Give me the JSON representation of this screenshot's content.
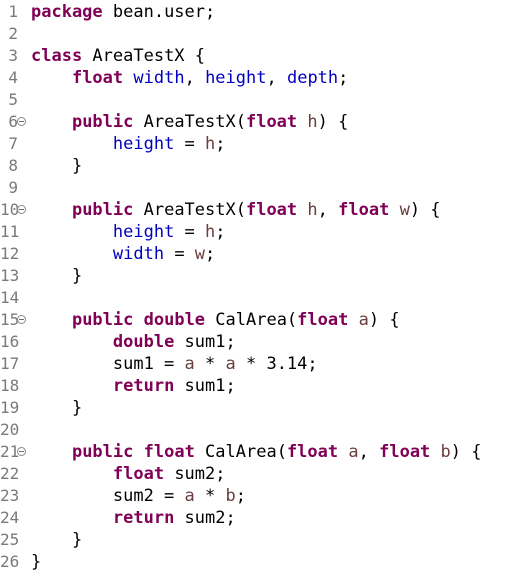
{
  "editor": {
    "lines": [
      {
        "number": "1",
        "tokens": [
          {
            "text": "package",
            "style": "keyword"
          },
          {
            "text": " bean.user;",
            "style": "plain"
          }
        ]
      },
      {
        "number": "2",
        "tokens": []
      },
      {
        "number": "3",
        "tokens": [
          {
            "text": "class",
            "style": "keyword"
          },
          {
            "text": " AreaTestX {",
            "style": "plain"
          }
        ]
      },
      {
        "number": "4",
        "tokens": [
          {
            "text": "    ",
            "style": "plain"
          },
          {
            "text": "float",
            "style": "keyword"
          },
          {
            "text": " ",
            "style": "plain"
          },
          {
            "text": "width",
            "style": "field"
          },
          {
            "text": ", ",
            "style": "plain"
          },
          {
            "text": "height",
            "style": "field"
          },
          {
            "text": ", ",
            "style": "plain"
          },
          {
            "text": "depth",
            "style": "field"
          },
          {
            "text": ";",
            "style": "plain"
          }
        ]
      },
      {
        "number": "5",
        "tokens": []
      },
      {
        "number": "6",
        "fold": true,
        "tokens": [
          {
            "text": "    ",
            "style": "plain"
          },
          {
            "text": "public",
            "style": "keyword"
          },
          {
            "text": " AreaTestX(",
            "style": "plain"
          },
          {
            "text": "float",
            "style": "keyword"
          },
          {
            "text": " ",
            "style": "plain"
          },
          {
            "text": "h",
            "style": "param"
          },
          {
            "text": ") {",
            "style": "plain"
          }
        ]
      },
      {
        "number": "7",
        "tokens": [
          {
            "text": "        ",
            "style": "plain"
          },
          {
            "text": "height",
            "style": "field"
          },
          {
            "text": " = ",
            "style": "plain"
          },
          {
            "text": "h",
            "style": "param"
          },
          {
            "text": ";",
            "style": "plain"
          }
        ]
      },
      {
        "number": "8",
        "tokens": [
          {
            "text": "    }",
            "style": "plain"
          }
        ]
      },
      {
        "number": "9",
        "tokens": []
      },
      {
        "number": "10",
        "fold": true,
        "tokens": [
          {
            "text": "    ",
            "style": "plain"
          },
          {
            "text": "public",
            "style": "keyword"
          },
          {
            "text": " AreaTestX(",
            "style": "plain"
          },
          {
            "text": "float",
            "style": "keyword"
          },
          {
            "text": " ",
            "style": "plain"
          },
          {
            "text": "h",
            "style": "param"
          },
          {
            "text": ", ",
            "style": "plain"
          },
          {
            "text": "float",
            "style": "keyword"
          },
          {
            "text": " ",
            "style": "plain"
          },
          {
            "text": "w",
            "style": "param"
          },
          {
            "text": ") {",
            "style": "plain"
          }
        ]
      },
      {
        "number": "11",
        "tokens": [
          {
            "text": "        ",
            "style": "plain"
          },
          {
            "text": "height",
            "style": "field"
          },
          {
            "text": " = ",
            "style": "plain"
          },
          {
            "text": "h",
            "style": "param"
          },
          {
            "text": ";",
            "style": "plain"
          }
        ]
      },
      {
        "number": "12",
        "tokens": [
          {
            "text": "        ",
            "style": "plain"
          },
          {
            "text": "width",
            "style": "field"
          },
          {
            "text": " = ",
            "style": "plain"
          },
          {
            "text": "w",
            "style": "param"
          },
          {
            "text": ";",
            "style": "plain"
          }
        ]
      },
      {
        "number": "13",
        "tokens": [
          {
            "text": "    }",
            "style": "plain"
          }
        ]
      },
      {
        "number": "14",
        "tokens": []
      },
      {
        "number": "15",
        "fold": true,
        "tokens": [
          {
            "text": "    ",
            "style": "plain"
          },
          {
            "text": "public",
            "style": "keyword"
          },
          {
            "text": " ",
            "style": "plain"
          },
          {
            "text": "double",
            "style": "keyword"
          },
          {
            "text": " CalArea(",
            "style": "plain"
          },
          {
            "text": "float",
            "style": "keyword"
          },
          {
            "text": " ",
            "style": "plain"
          },
          {
            "text": "a",
            "style": "param"
          },
          {
            "text": ") {",
            "style": "plain"
          }
        ]
      },
      {
        "number": "16",
        "tokens": [
          {
            "text": "        ",
            "style": "plain"
          },
          {
            "text": "double",
            "style": "keyword"
          },
          {
            "text": " sum1;",
            "style": "plain"
          }
        ]
      },
      {
        "number": "17",
        "tokens": [
          {
            "text": "        sum1 = ",
            "style": "plain"
          },
          {
            "text": "a",
            "style": "param"
          },
          {
            "text": " * ",
            "style": "plain"
          },
          {
            "text": "a",
            "style": "param"
          },
          {
            "text": " * 3.14;",
            "style": "plain"
          }
        ]
      },
      {
        "number": "18",
        "tokens": [
          {
            "text": "        ",
            "style": "plain"
          },
          {
            "text": "return",
            "style": "keyword"
          },
          {
            "text": " sum1;",
            "style": "plain"
          }
        ]
      },
      {
        "number": "19",
        "tokens": [
          {
            "text": "    }",
            "style": "plain"
          }
        ]
      },
      {
        "number": "20",
        "tokens": []
      },
      {
        "number": "21",
        "fold": true,
        "tokens": [
          {
            "text": "    ",
            "style": "plain"
          },
          {
            "text": "public",
            "style": "keyword"
          },
          {
            "text": " ",
            "style": "plain"
          },
          {
            "text": "float",
            "style": "keyword"
          },
          {
            "text": " CalArea(",
            "style": "plain"
          },
          {
            "text": "float",
            "style": "keyword"
          },
          {
            "text": " ",
            "style": "plain"
          },
          {
            "text": "a",
            "style": "param"
          },
          {
            "text": ", ",
            "style": "plain"
          },
          {
            "text": "float",
            "style": "keyword"
          },
          {
            "text": " ",
            "style": "plain"
          },
          {
            "text": "b",
            "style": "param"
          },
          {
            "text": ") {",
            "style": "plain"
          }
        ]
      },
      {
        "number": "22",
        "tokens": [
          {
            "text": "        ",
            "style": "plain"
          },
          {
            "text": "float",
            "style": "keyword"
          },
          {
            "text": " sum2;",
            "style": "plain"
          }
        ]
      },
      {
        "number": "23",
        "tokens": [
          {
            "text": "        sum2 = ",
            "style": "plain"
          },
          {
            "text": "a",
            "style": "param"
          },
          {
            "text": " * ",
            "style": "plain"
          },
          {
            "text": "b",
            "style": "param"
          },
          {
            "text": ";",
            "style": "plain"
          }
        ]
      },
      {
        "number": "24",
        "tokens": [
          {
            "text": "        ",
            "style": "plain"
          },
          {
            "text": "return",
            "style": "keyword"
          },
          {
            "text": " sum2;",
            "style": "plain"
          }
        ]
      },
      {
        "number": "25",
        "tokens": [
          {
            "text": "    }",
            "style": "plain"
          }
        ]
      },
      {
        "number": "26",
        "tokens": [
          {
            "text": "}",
            "style": "plain"
          }
        ]
      }
    ]
  }
}
